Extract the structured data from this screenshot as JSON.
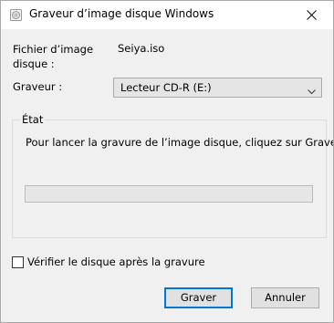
{
  "window": {
    "title": "Graveur d’image disque Windows",
    "icon": "disc-burn-icon",
    "close_icon": "close-icon"
  },
  "fields": {
    "image_label_line1": "Fichier d’image",
    "image_label_line2": "disque :",
    "image_value": "Seiya.iso",
    "burner_label": "Graveur :",
    "burner_selected": "Lecteur CD-R (E:)"
  },
  "status_group": {
    "legend": "État",
    "message": "Pour lancer la gravure de l’image disque, cliquez sur Graver.",
    "progress": 0
  },
  "verify": {
    "label": "Vérifier le disque après la gravure",
    "checked": false
  },
  "buttons": {
    "burn": "Graver",
    "cancel": "Annuler"
  },
  "colors": {
    "accent": "#0078d7",
    "dialog_bg": "#f0f0f0",
    "titlebar_bg": "#ffffff"
  }
}
